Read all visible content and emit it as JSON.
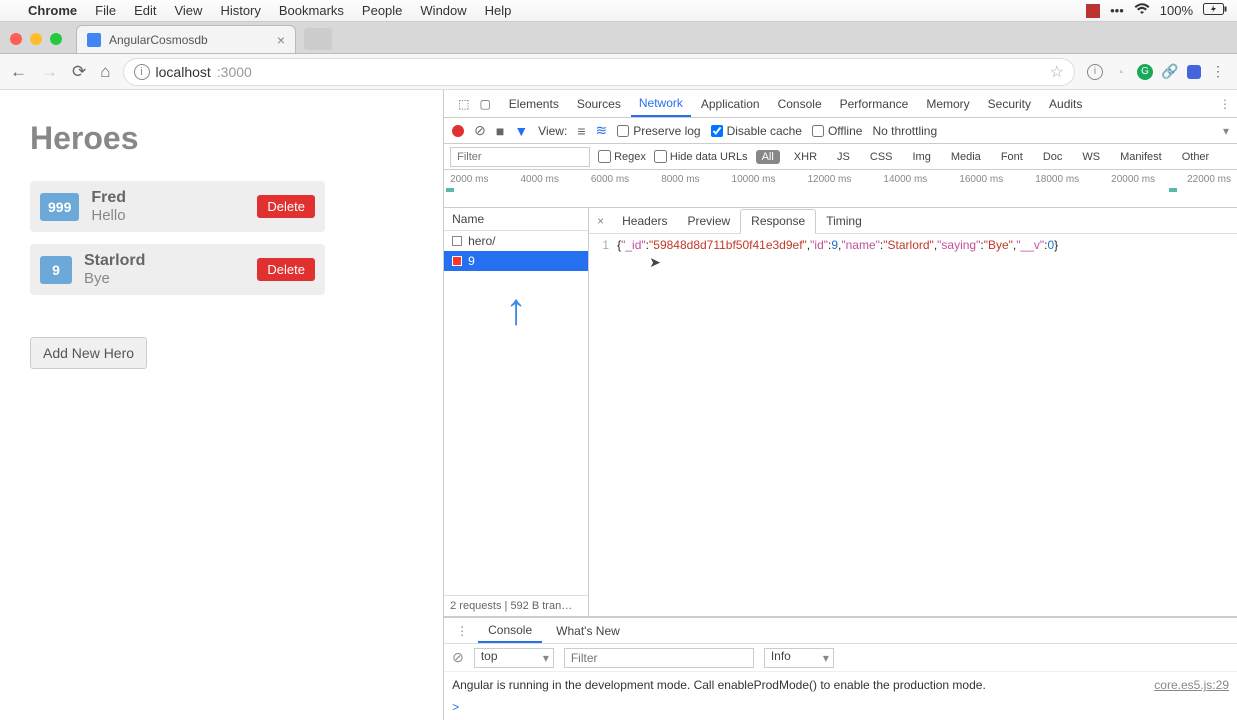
{
  "menubar": {
    "app": "Chrome",
    "items": [
      "File",
      "Edit",
      "View",
      "History",
      "Bookmarks",
      "People",
      "Window",
      "Help"
    ],
    "battery": "100%"
  },
  "tab": {
    "title": "AngularCosmosdb"
  },
  "url": {
    "host": "localhost",
    "port": ":3000"
  },
  "page": {
    "title": "Heroes",
    "heroes": [
      {
        "id": "999",
        "name": "Fred",
        "saying": "Hello",
        "del": "Delete"
      },
      {
        "id": "9",
        "name": "Starlord",
        "saying": "Bye",
        "del": "Delete"
      }
    ],
    "addBtn": "Add New Hero"
  },
  "devtools": {
    "tabs": [
      "Elements",
      "Sources",
      "Network",
      "Application",
      "Console",
      "Performance",
      "Memory",
      "Security",
      "Audits"
    ],
    "activeTab": "Network",
    "toolbar2": {
      "view": "View:",
      "preserve": "Preserve log",
      "disableCache": "Disable cache",
      "offline": "Offline",
      "throttling": "No throttling"
    },
    "toolbar3": {
      "filterPh": "Filter",
      "regex": "Regex",
      "hideData": "Hide data URLs",
      "chips": [
        "All",
        "XHR",
        "JS",
        "CSS",
        "Img",
        "Media",
        "Font",
        "Doc",
        "WS",
        "Manifest",
        "Other"
      ]
    },
    "timeline": [
      "2000 ms",
      "4000 ms",
      "6000 ms",
      "8000 ms",
      "10000 ms",
      "12000 ms",
      "14000 ms",
      "16000 ms",
      "18000 ms",
      "20000 ms",
      "22000 ms"
    ],
    "netList": {
      "hdr": "Name",
      "rows": [
        "hero/",
        "9"
      ],
      "status": "2 requests | 592 B tran…"
    },
    "detailTabs": [
      "Headers",
      "Preview",
      "Response",
      "Timing"
    ],
    "detailActive": "Response",
    "response": {
      "line": "1",
      "_id": "\"59848d8d711bf50f41e3d9ef\"",
      "id": "9",
      "name": "\"Starlord\"",
      "saying": "\"Bye\"",
      "v": "0"
    },
    "drawer": {
      "tabs": [
        "Console",
        "What's New"
      ],
      "active": "Console",
      "context": "top",
      "filterPh": "Filter",
      "level": "Info",
      "msg": "Angular is running in the development mode. Call enableProdMode() to enable the production mode.",
      "src": "core.es5.js:29",
      "prompt": ">"
    }
  }
}
